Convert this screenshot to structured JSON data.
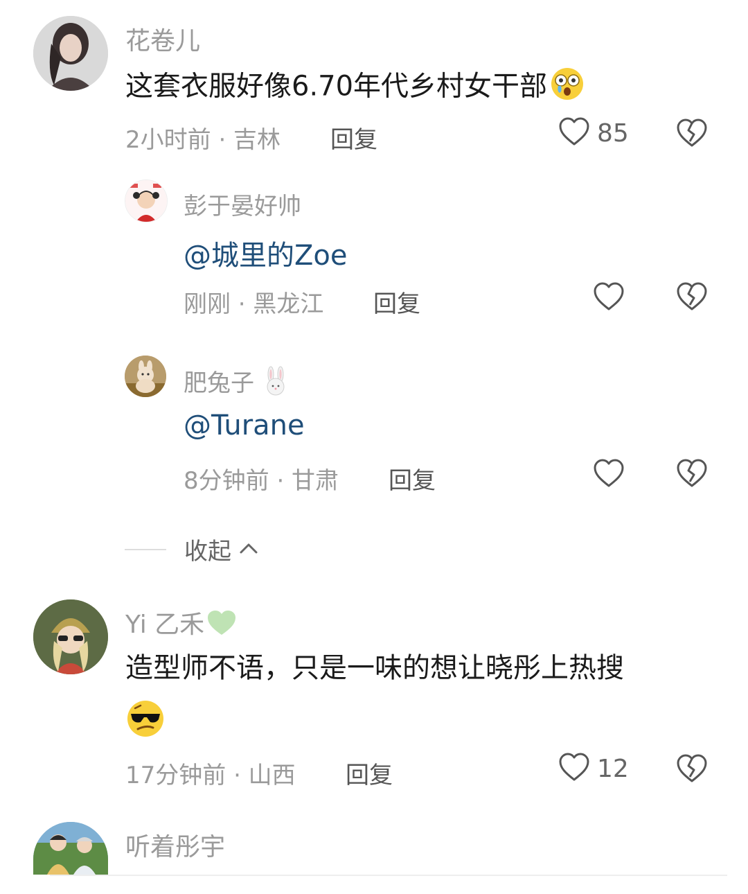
{
  "comments": [
    {
      "username": "花卷儿",
      "text": "这套衣服好像6.70年代乡村女干部",
      "emoji": "astonished-crying-face-emoji",
      "meta": "2小时前 · 吉林",
      "reply_label": "回复",
      "likes": "85",
      "replies": [
        {
          "username": "彭于晏好帅",
          "mention": "@城里的Zoe",
          "meta": "刚刚 · 黑龙江",
          "reply_label": "回复"
        },
        {
          "username": "肥兔子",
          "username_emoji": "rabbit-emoji",
          "mention": "@Turane",
          "meta": "8分钟前 · 甘肃",
          "reply_label": "回复"
        }
      ],
      "collapse_label": "收起"
    },
    {
      "username": "Yi 乙禾",
      "username_emoji": "green-heart-emoji",
      "text": "造型师不语，只是一味的想让晓彤上热搜",
      "emoji": "cool-sunglasses-face-emoji",
      "meta": "17分钟前 · 山西",
      "reply_label": "回复",
      "likes": "12"
    },
    {
      "username": "听着彤宇"
    }
  ],
  "colors": {
    "username": "#9a9a9a",
    "mention": "#1f4e79",
    "body_text": "#1a1a1a"
  }
}
